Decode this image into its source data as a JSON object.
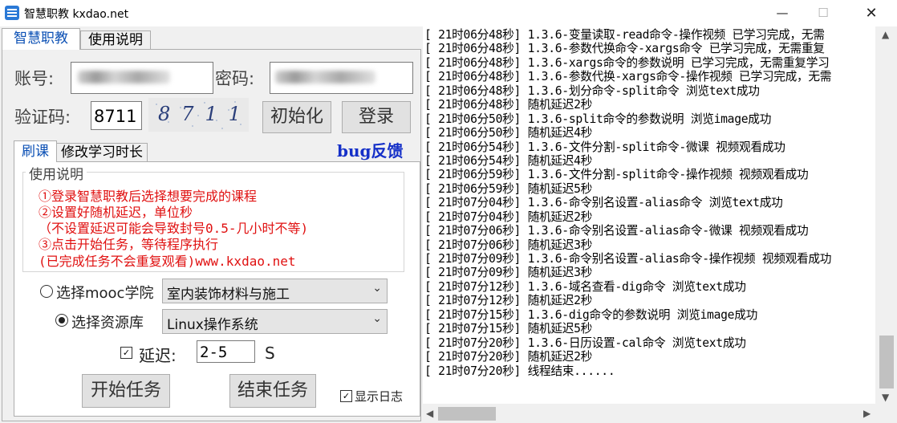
{
  "window": {
    "title": "智慧职教 kxdao.net",
    "min_glyph": "—",
    "max_glyph": "☐",
    "close_glyph": "✕"
  },
  "tabs": {
    "main": "智慧职教",
    "help": "使用说明"
  },
  "login": {
    "account_label": "账号:",
    "password_label": "密码:",
    "captcha_label": "验证码:",
    "captcha_value": "8711",
    "captcha_image_text": "8711",
    "init_button": "初始化",
    "login_button": "登录"
  },
  "bug_link": "bug反馈",
  "subtabs": {
    "brush": "刷课",
    "time": "修改学习时长"
  },
  "help": {
    "legend": "使用说明",
    "lines": [
      "①登录智慧职教后选择想要完成的课程",
      "②设置好随机延迟，单位秒",
      "（不设置延迟可能会导致封号0.5-几小时不等)",
      "③点击开始任务，等待程序执行",
      "(已完成任务不会重复观看)www.kxdao.net"
    ]
  },
  "options": {
    "mooc_label": "选择mooc学院",
    "mooc_selected": false,
    "mooc_value": "室内装饰材料与施工",
    "resource_label": "选择资源库",
    "resource_selected": true,
    "resource_value": "Linux操作系统",
    "delay_label": "延迟:",
    "delay_checked": true,
    "delay_value": "2-5",
    "delay_unit": "S"
  },
  "actions": {
    "start": "开始任务",
    "stop": "结束任务",
    "show_log": "显示日志",
    "show_log_checked": true
  },
  "log": [
    "[ 21时06分48秒] 1.3.6-变量读取-read命令-操作视频 已学习完成，无需",
    "[ 21时06分48秒] 1.3.6-参数代换命令-xargs命令 已学习完成，无需重复",
    "[ 21时06分48秒] 1.3.6-xargs命令的参数说明 已学习完成，无需重复学习",
    "[ 21时06分48秒] 1.3.6-参数代换-xargs命令-操作视频 已学习完成，无需",
    "[ 21时06分48秒] 1.3.6-划分命令-split命令 浏览text成功",
    "[ 21时06分48秒] 随机延迟2秒",
    "[ 21时06分50秒] 1.3.6-split命令的参数说明 浏览image成功",
    "[ 21时06分50秒] 随机延迟4秒",
    "[ 21时06分54秒] 1.3.6-文件分割-split命令-微课 视频观看成功",
    "[ 21时06分54秒] 随机延迟4秒",
    "[ 21时06分59秒] 1.3.6-文件分割-split命令-操作视频 视频观看成功",
    "[ 21时06分59秒] 随机延迟5秒",
    "[ 21时07分04秒] 1.3.6-命令别名设置-alias命令 浏览text成功",
    "[ 21时07分04秒] 随机延迟2秒",
    "[ 21时07分06秒] 1.3.6-命令别名设置-alias命令-微课 视频观看成功",
    "[ 21时07分06秒] 随机延迟3秒",
    "[ 21时07分09秒] 1.3.6-命令别名设置-alias命令-操作视频 视频观看成功",
    "[ 21时07分09秒] 随机延迟3秒",
    "[ 21时07分12秒] 1.3.6-域名查看-dig命令 浏览text成功",
    "[ 21时07分12秒] 随机延迟2秒",
    "[ 21时07分15秒] 1.3.6-dig命令的参数说明 浏览image成功",
    "[ 21时07分15秒] 随机延迟5秒",
    "[ 21时07分20秒] 1.3.6-日历设置-cal命令 浏览text成功",
    "[ 21时07分20秒] 随机延迟2秒",
    "[ 21时07分20秒] 线程结束......"
  ]
}
